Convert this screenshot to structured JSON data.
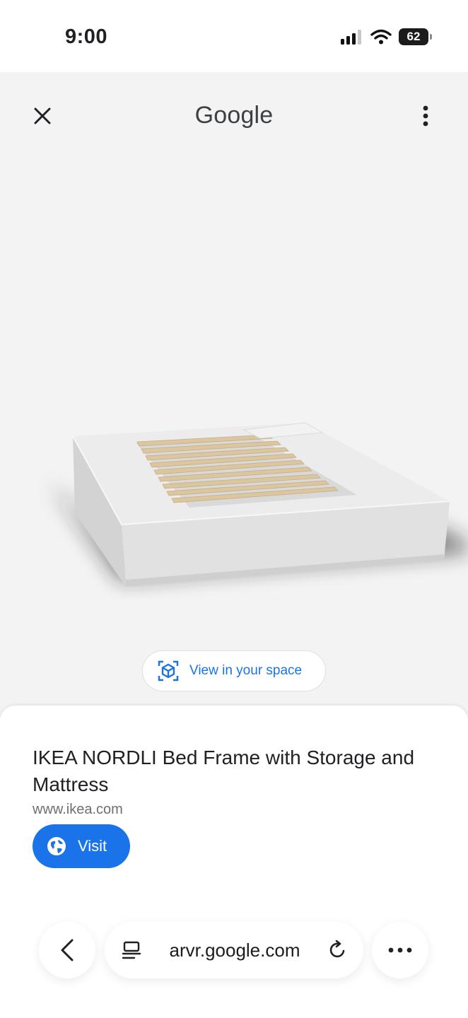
{
  "status_bar": {
    "time": "9:00",
    "battery": "62"
  },
  "viewer": {
    "logo_text": "Google"
  },
  "ar_button": {
    "label": "View in your space"
  },
  "product": {
    "title": "IKEA NORDLI Bed Frame with Storage and Mattress",
    "domain": "www.ikea.com",
    "visit_label": "Visit"
  },
  "browser": {
    "url": "arvr.google.com"
  },
  "colors": {
    "accent": "#1a73e8",
    "background": "#f3f3f3"
  },
  "icons": {
    "close": "close-icon",
    "menu": "kebab-menu-icon",
    "ar": "ar-cube-icon",
    "globe": "globe-icon",
    "back": "chevron-left-icon",
    "tabs": "page-menu-icon",
    "reload": "reload-icon",
    "more": "more-horizontal-icon"
  }
}
